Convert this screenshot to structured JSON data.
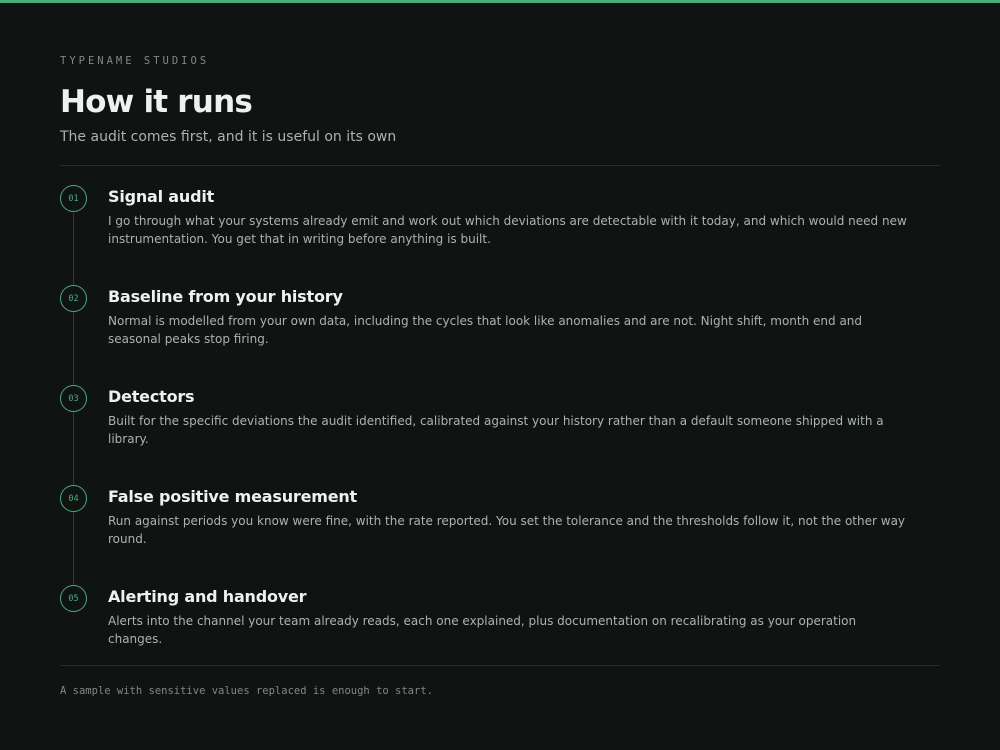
{
  "header": {
    "eyebrow": "TYPENAME STUDIOS",
    "title": "How it runs",
    "subtitle": "The audit comes first, and it is useful on its own"
  },
  "steps": [
    {
      "number": "01",
      "title": "Signal audit",
      "description": "I go through what your systems already emit and work out which deviations are detectable with it today, and which would need new instrumentation. You get that in writing before anything is built."
    },
    {
      "number": "02",
      "title": "Baseline from your history",
      "description": "Normal is modelled from your own data, including the cycles that look like anomalies and are not. Night shift, month end and seasonal peaks stop firing."
    },
    {
      "number": "03",
      "title": "Detectors",
      "description": "Built for the specific deviations the audit identified, calibrated against your history rather than a default someone shipped with a library."
    },
    {
      "number": "04",
      "title": "False positive measurement",
      "description": "Run against periods you know were fine, with the rate reported. You set the tolerance and the thresholds follow it, not the other way round."
    },
    {
      "number": "05",
      "title": "Alerting and handover",
      "description": "Alerts into the channel your team already reads, each one explained, plus documentation on recalibrating as your operation changes."
    }
  ],
  "footer": {
    "note": "A sample with sensitive values replaced is enough to start."
  },
  "colors": {
    "background": "#0f1413",
    "accent": "#4caa79",
    "heading": "#eef1ef",
    "body_text": "#aab3af",
    "muted": "#7f8985"
  }
}
